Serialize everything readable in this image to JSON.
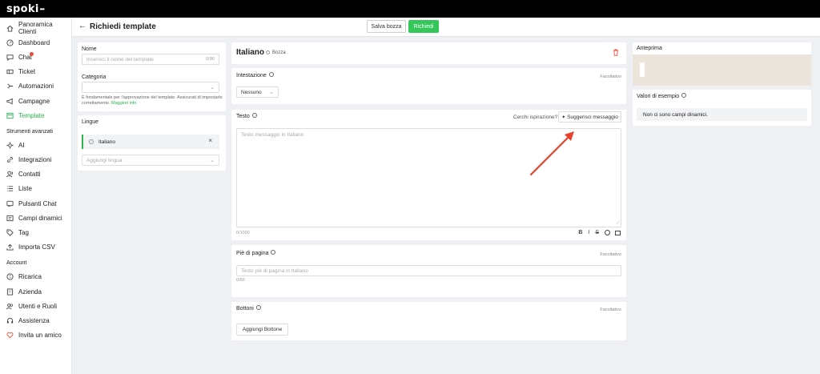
{
  "app": {
    "logo": "spoki",
    "logo_dots": "•••"
  },
  "header": {
    "title": "Richiedi template",
    "save_draft": "Salva bozza",
    "request": "Richiedi"
  },
  "sidebar": {
    "items": [
      {
        "label": "Panoramica Clienti",
        "icon": "home-icon"
      },
      {
        "label": "Dashboard",
        "icon": "gauge-icon"
      },
      {
        "label": "Chat",
        "icon": "chat-icon"
      },
      {
        "label": "Ticket",
        "icon": "ticket-icon"
      },
      {
        "label": "Automazioni",
        "icon": "automation-icon"
      },
      {
        "label": "Campagne",
        "icon": "megaphone-icon"
      },
      {
        "label": "Template",
        "icon": "template-icon"
      }
    ],
    "tools_title": "Strumenti avanzati",
    "tools": [
      {
        "label": "AI",
        "icon": "sparkle-icon"
      },
      {
        "label": "Integrazioni",
        "icon": "link-icon"
      },
      {
        "label": "Contatti",
        "icon": "contacts-icon"
      },
      {
        "label": "Liste",
        "icon": "list-icon"
      },
      {
        "label": "Pulsanti Chat",
        "icon": "chat-button-icon"
      },
      {
        "label": "Campi dinamici",
        "icon": "fields-icon"
      },
      {
        "label": "Tag",
        "icon": "tag-icon"
      },
      {
        "label": "Importa CSV",
        "icon": "upload-icon"
      }
    ],
    "account_title": "Account",
    "account": [
      {
        "label": "Ricarica",
        "icon": "coin-icon"
      },
      {
        "label": "Azienda",
        "icon": "building-icon"
      },
      {
        "label": "Utenti e Ruoli",
        "icon": "users-icon"
      },
      {
        "label": "Assistenza",
        "icon": "headset-icon"
      },
      {
        "label": "Invita un amico",
        "icon": "heart-icon"
      }
    ]
  },
  "name_card": {
    "label": "Nome",
    "placeholder": "Inserisci il nome del template",
    "counter": "0/90"
  },
  "category_card": {
    "label": "Categoria",
    "help": "È fondamentale per l'approvazione del template. Assicurati di impostarlo correttamente.",
    "link": "Maggiori info"
  },
  "languages_card": {
    "label": "Lingue",
    "selected": "Italiano",
    "remove": "×",
    "add_placeholder": "Aggiungi lingua"
  },
  "editor": {
    "language": "Italiano",
    "status": "Bozza",
    "header_label": "Intestazione",
    "optional": "Facoltativo",
    "header_select": "Nessuno",
    "text_label": "Testo",
    "inspiration": "Cerchi ispirazione?",
    "suggest": "Suggerisci messaggio",
    "text_placeholder": "Testo messaggio in Italiano",
    "text_counter": "0/1000",
    "format": {
      "bold": "B",
      "italic": "I",
      "strike": "S"
    },
    "footer_label": "Piè di pagina",
    "footer_placeholder": "Testo piè di pagina in Italiano",
    "footer_counter": "0/60",
    "buttons_label": "Bottoni",
    "add_button": "Aggiungi Bottone"
  },
  "preview": {
    "label": "Anteprima"
  },
  "examples": {
    "label": "Valori di esempio",
    "empty": "Non ci sono campi dinamici."
  },
  "colors": {
    "accent": "#2bb34d",
    "request_button": "#34c759",
    "annotation_arrow": "#e8412c"
  }
}
